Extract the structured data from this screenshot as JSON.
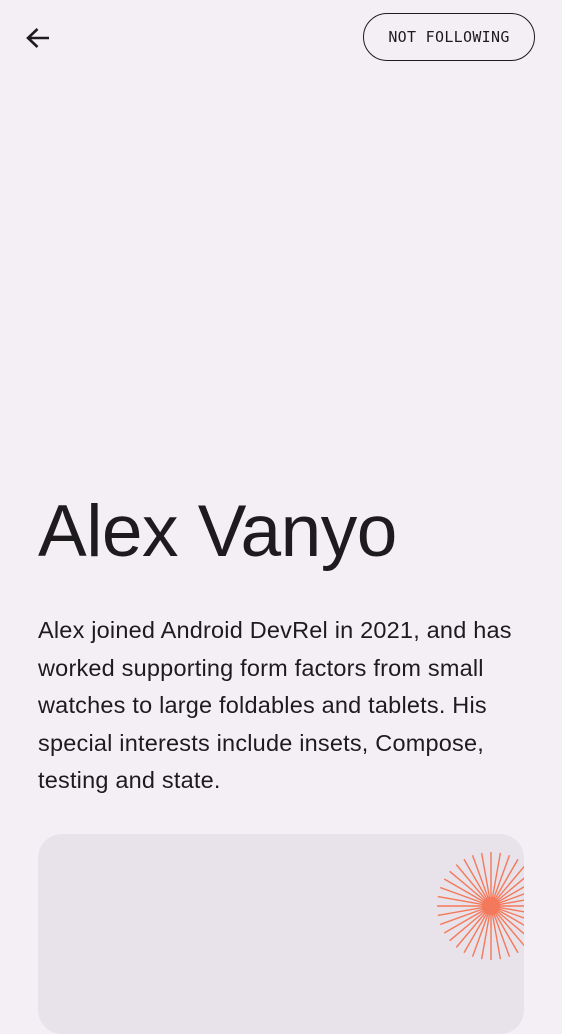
{
  "header": {
    "back_icon": "arrow-back-icon",
    "follow_label": "NOT FOLLOWING"
  },
  "author": {
    "name": "Alex Vanyo",
    "bio": "Alex joined Android DevRel in 2021, and has worked supporting form factors from small watches to large foldables and tablets. His special interests include insets, Compose, testing and state."
  },
  "card": {
    "decoration_icon": "starburst-icon",
    "accent_color": "#f4795b"
  },
  "colors": {
    "background": "#f4eff4",
    "text": "#1d1b1e",
    "card": "#e8e2ea"
  }
}
